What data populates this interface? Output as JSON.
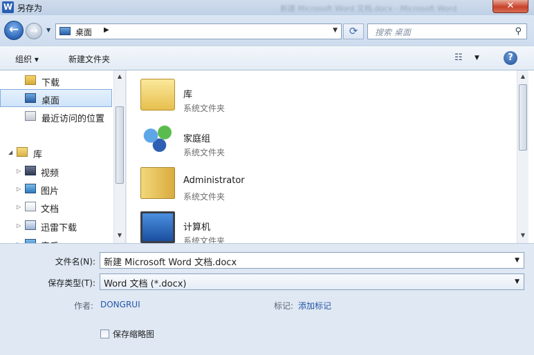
{
  "window": {
    "title": "另存为",
    "background_title": "新建 Microsoft Word 文档.docx - Microsoft Word",
    "app_icon": "W",
    "close_label": "✕"
  },
  "nav": {
    "back_icon": "arrow-left",
    "forward_icon": "arrow-right",
    "address": "桌面",
    "search_placeholder": "搜索 桌面"
  },
  "toolbar": {
    "organize_label": "组织 ▾",
    "new_folder_label": "新建文件夹",
    "help_label": "?"
  },
  "sidebar": {
    "items": [
      {
        "label": "下载",
        "icon": "download-folder"
      },
      {
        "label": "桌面",
        "icon": "desktop",
        "selected": true
      },
      {
        "label": "最近访问的位置",
        "icon": "recent-places"
      },
      {
        "label": "库",
        "icon": "library",
        "expanded": true
      },
      {
        "label": "视频",
        "icon": "video-library"
      },
      {
        "label": "图片",
        "icon": "pictures-library"
      },
      {
        "label": "文档",
        "icon": "documents-library"
      },
      {
        "label": "迅雷下载",
        "icon": "thunder-download"
      },
      {
        "label": "音乐",
        "icon": "music-library"
      }
    ]
  },
  "files": [
    {
      "name": "库",
      "type": "系统文件夹",
      "icon": "library-icon"
    },
    {
      "name": "家庭组",
      "type": "系统文件夹",
      "icon": "homegroup-icon"
    },
    {
      "name": "Administrator",
      "type": "系统文件夹",
      "icon": "user-folder-icon"
    },
    {
      "name": "计算机",
      "type": "系统文件夹",
      "icon": "computer-icon"
    }
  ],
  "form": {
    "filename_label": "文件名(N):",
    "filename_value": "新建 Microsoft Word 文档.docx",
    "filetype_label": "保存类型(T):",
    "filetype_value": "Word 文档 (*.docx)",
    "author_label": "作者:",
    "author_value": "DONGRUI",
    "tags_label": "标记:",
    "tags_value": "添加标记",
    "thumbnail_label": "保存缩略图"
  }
}
